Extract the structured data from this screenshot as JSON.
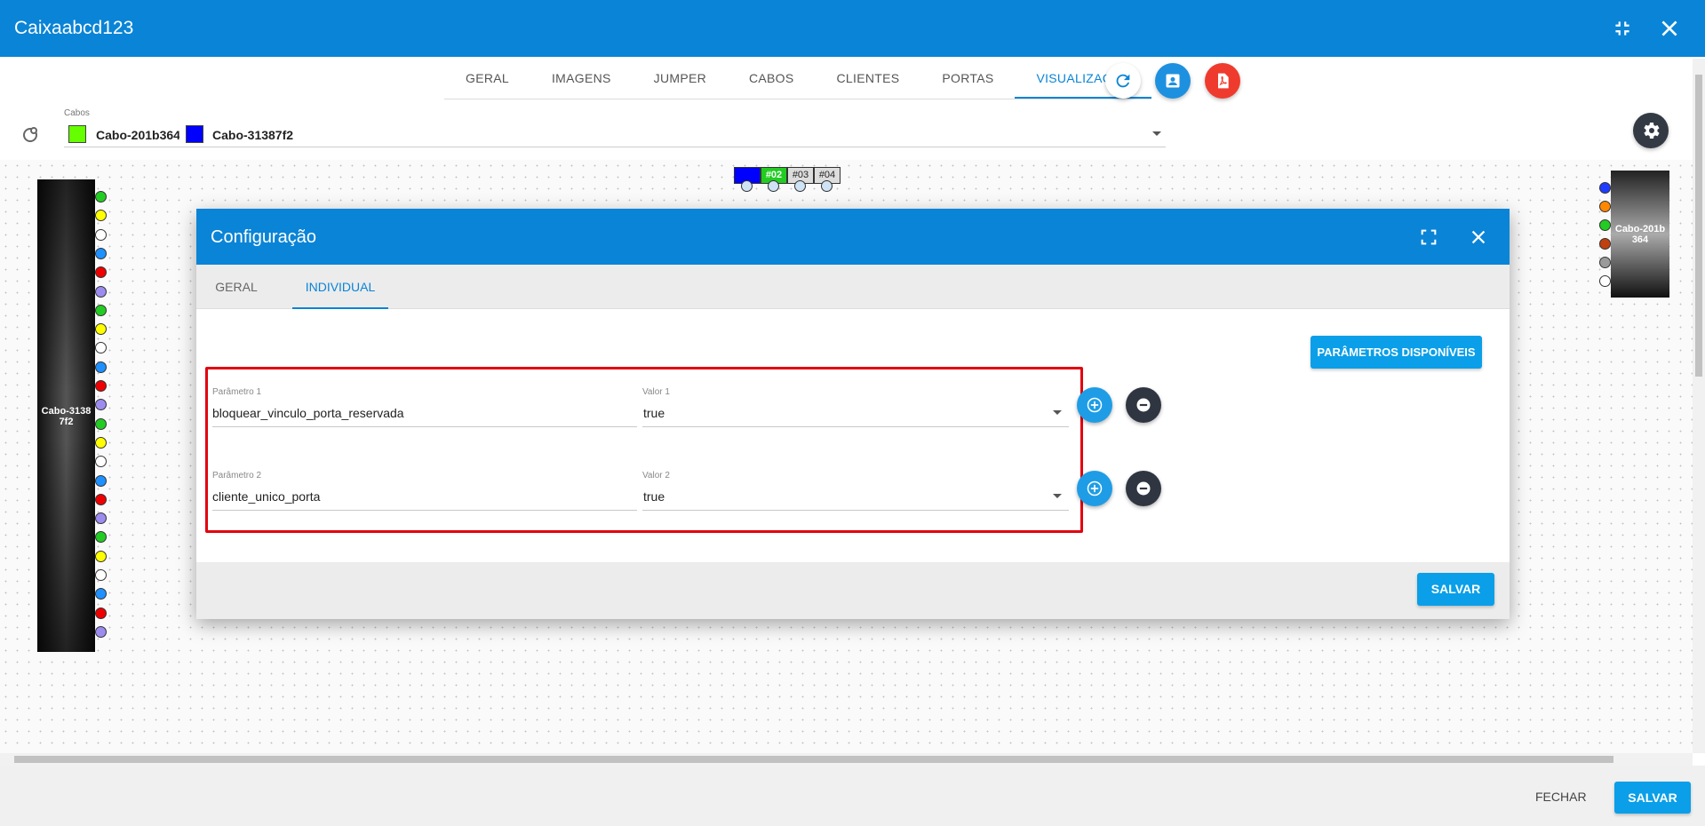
{
  "window": {
    "title": "Caixaabcd123"
  },
  "tabs": [
    {
      "label": "GERAL",
      "active": false
    },
    {
      "label": "IMAGENS",
      "active": false
    },
    {
      "label": "JUMPER",
      "active": false
    },
    {
      "label": "CABOS",
      "active": false
    },
    {
      "label": "CLIENTES",
      "active": false
    },
    {
      "label": "PORTAS",
      "active": false
    },
    {
      "label": "VISUALIZAÇÃO",
      "active": true
    }
  ],
  "cables_select": {
    "label": "Cabos",
    "chips": [
      {
        "name": "Cabo-201b364",
        "color": "#66ff00"
      },
      {
        "name": "Cabo-31387f2",
        "color": "#0000ff"
      }
    ]
  },
  "canvas": {
    "left_cable_label": "Cabo-3138 7f2",
    "right_cable_label": "Cabo-201b 364",
    "splitter_ports": [
      "",
      "#02",
      "#03",
      "#04"
    ],
    "left_port_colors": [
      "#22cc22",
      "#ffff00",
      "#ffffff",
      "#1e90ff",
      "#ee0000",
      "#9c8cf0",
      "#22cc22",
      "#ffff00",
      "#ffffff",
      "#1e90ff",
      "#ee0000",
      "#9c8cf0",
      "#22cc22",
      "#ffff00",
      "#ffffff",
      "#1e90ff",
      "#ee0000",
      "#9c8cf0",
      "#22cc22",
      "#ffff00",
      "#ffffff",
      "#1e90ff",
      "#ee0000",
      "#9c8cf0"
    ],
    "right_port_colors": [
      "#1e3cff",
      "#ff8800",
      "#22cc22",
      "#c04010",
      "#9a9a9a",
      "#ffffff"
    ]
  },
  "modal": {
    "title": "Configuração",
    "tabs": [
      {
        "label": "GERAL",
        "active": false
      },
      {
        "label": "INDIVIDUAL",
        "active": true
      }
    ],
    "available_params_button": "PARÂMETROS DISPONÍVEIS",
    "params": [
      {
        "param_label": "Parâmetro 1",
        "param_value": "bloquear_vinculo_porta_reservada",
        "value_label": "Valor 1",
        "value": "true"
      },
      {
        "param_label": "Parâmetro 2",
        "param_value": "cliente_unico_porta",
        "value_label": "Valor 2",
        "value": "true"
      }
    ],
    "save_button": "SALVAR"
  },
  "footer": {
    "close_button": "FECHAR",
    "save_button": "SALVAR"
  },
  "colors": {
    "primary": "#0a84d6",
    "accent": "#0a9fe8",
    "danger": "#ef3b2d",
    "highlight": "#e3000f"
  },
  "icons": [
    "collapse-icon",
    "close-icon",
    "refresh-icon",
    "contact-icon",
    "pdf-icon",
    "settings-icon",
    "cable-options-icon",
    "fullscreen-icon",
    "plus-icon",
    "minus-icon"
  ]
}
